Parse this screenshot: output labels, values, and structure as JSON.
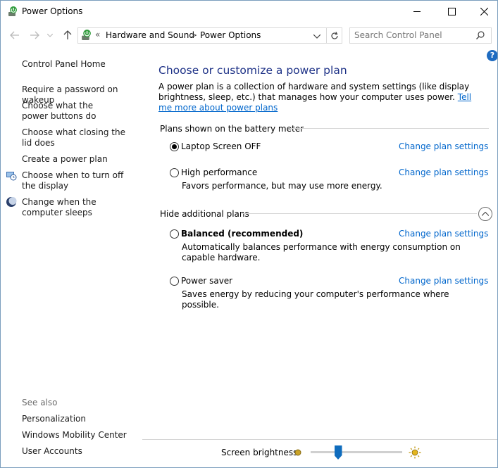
{
  "window": {
    "title": "Power Options"
  },
  "address": {
    "crumbs": [
      "Hardware and Sound",
      "Power Options"
    ],
    "chevron": "«",
    "separator": ">"
  },
  "search": {
    "placeholder": "Search Control Panel"
  },
  "help_label": "?",
  "left": {
    "items": [
      "Control Panel Home",
      "Require a password on wakeup",
      "Choose what the power buttons do",
      "Choose what closing the lid does",
      "Create a power plan",
      "Choose when to turn off the display",
      "Change when the computer sleeps"
    ],
    "see_also_label": "See also",
    "see_also": [
      "Personalization",
      "Windows Mobility Center",
      "User Accounts"
    ]
  },
  "main": {
    "title": "Choose or customize a power plan",
    "description": "A power plan is a collection of hardware and system settings (like display brightness, sleep, etc.) that manages how your computer uses power.",
    "more_link": "Tell me more about power plans",
    "group1_label": "Plans shown on the battery meter",
    "group2_label": "Hide additional plans",
    "change_label": "Change plan settings",
    "plans": [
      {
        "name": "Laptop Screen OFF",
        "desc": "",
        "selected": true
      },
      {
        "name": "High performance",
        "desc": "Favors performance, but may use more energy.",
        "selected": false
      },
      {
        "name": "Balanced (recommended)",
        "desc": "Automatically balances performance with energy consumption on capable hardware.",
        "selected": false
      },
      {
        "name": "Power saver",
        "desc": "Saves energy by reducing your computer's performance where possible.",
        "selected": false
      }
    ]
  },
  "brightness": {
    "label": "Screen brightness:",
    "level": 0.3
  },
  "colors": {
    "link": "#0066cc",
    "heading": "#1e3287",
    "accent": "#0f6cbd"
  }
}
